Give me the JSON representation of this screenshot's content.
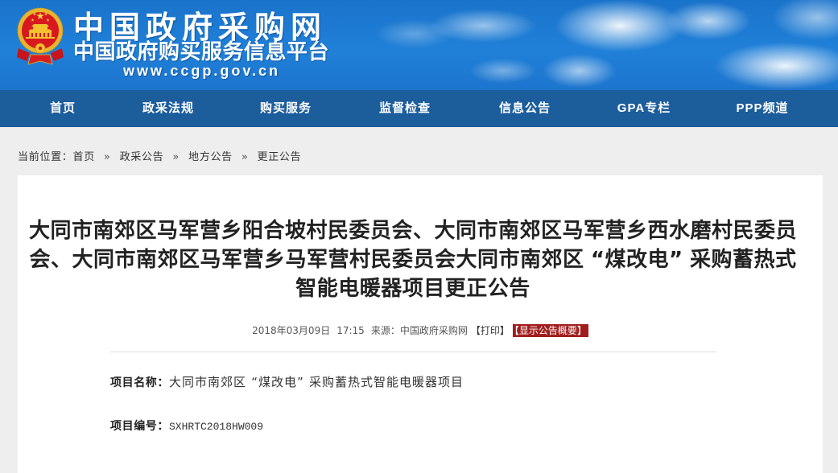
{
  "colors": {
    "banner_blue": "#2080d8",
    "nav_bg": "#1c5d9c",
    "page_bg": "#eeeeee",
    "summary_button_bg": "#a11d1d"
  },
  "header": {
    "emblem_icon": "national-emblem-icon",
    "site_title": "中国政府采购网",
    "site_subtitle": "中国政府购买服务信息平台",
    "site_url": "www.ccgp.gov.cn"
  },
  "nav": {
    "items": [
      {
        "label": "首页"
      },
      {
        "label": "政采法规"
      },
      {
        "label": "购买服务"
      },
      {
        "label": "监督检查"
      },
      {
        "label": "信息公告"
      },
      {
        "label": "GPA专栏"
      },
      {
        "label": "PPP频道"
      }
    ]
  },
  "breadcrumb": {
    "prefix": "当前位置：",
    "separator": "»",
    "items": [
      "首页",
      "政采公告",
      "地方公告",
      "更正公告"
    ]
  },
  "article": {
    "title": "大同市南郊区马军营乡阳合坡村民委员会、大同市南郊区马军营乡西水磨村民委员会、大同市南郊区马军营乡马军营村民委员会大同市南郊区“煤改电”采购蓄热式智能电暖器项目更正公告",
    "meta": {
      "date": "2018年03月09日",
      "time": "17:15",
      "source_label": "来源：",
      "source": "中国政府采购网",
      "print_link": "【打印】",
      "summary_button": "【显示公告概要】"
    },
    "fields": [
      {
        "label": "项目名称：",
        "value": "大同市南郊区“煤改电”采购蓄热式智能电暖器项目"
      },
      {
        "label": "项目编号：",
        "value": "SXHRTC2018HW009"
      }
    ]
  }
}
